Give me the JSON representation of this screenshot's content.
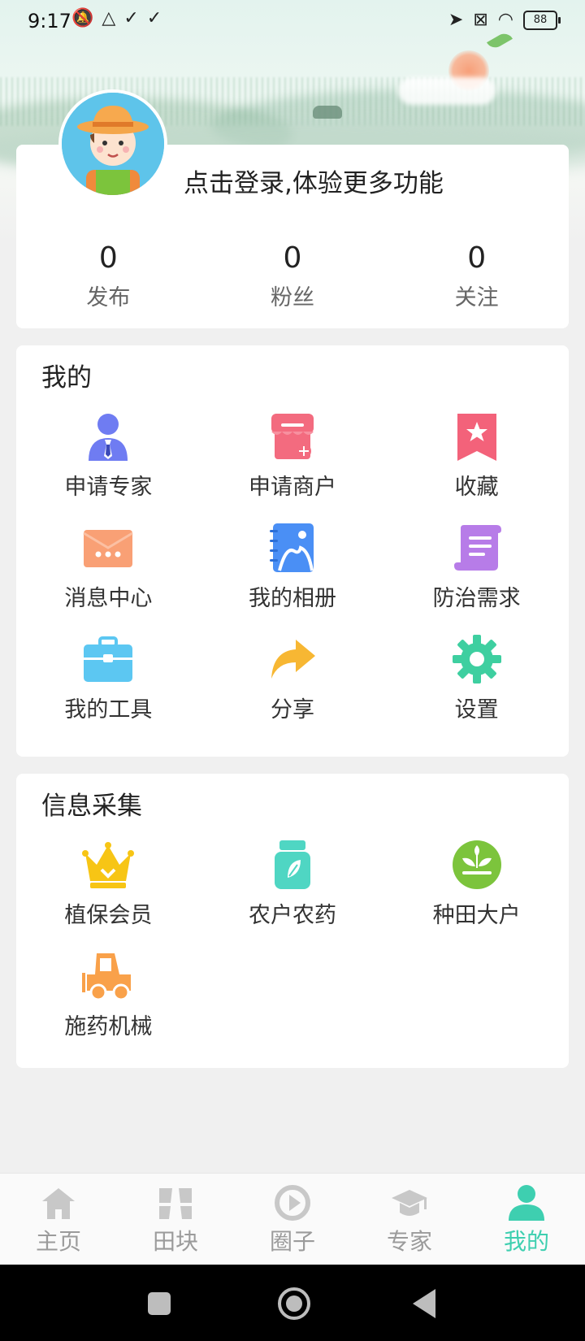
{
  "status_bar": {
    "time": "9:17",
    "battery": "88"
  },
  "profile": {
    "login_prompt": "点击登录,体验更多功能",
    "stats": [
      {
        "value": "0",
        "label": "发布"
      },
      {
        "value": "0",
        "label": "粉丝"
      },
      {
        "value": "0",
        "label": "关注"
      }
    ]
  },
  "mine": {
    "title": "我的",
    "items": [
      {
        "label": "申请专家",
        "icon": "expert-icon",
        "color": "#6f7cf2"
      },
      {
        "label": "申请商户",
        "icon": "store-icon",
        "color": "#f36b7f"
      },
      {
        "label": "收藏",
        "icon": "bookmark-icon",
        "color": "#f3627a"
      },
      {
        "label": "消息中心",
        "icon": "message-icon",
        "color": "#f9a075"
      },
      {
        "label": "我的相册",
        "icon": "album-icon",
        "color": "#4a8ff5"
      },
      {
        "label": "防治需求",
        "icon": "scroll-icon",
        "color": "#b77ce8"
      },
      {
        "label": "我的工具",
        "icon": "toolbox-icon",
        "color": "#5cc7f2"
      },
      {
        "label": "分享",
        "icon": "share-icon",
        "color": "#f7b733"
      },
      {
        "label": "设置",
        "icon": "gear-icon",
        "color": "#3ecfa0"
      }
    ]
  },
  "collect": {
    "title": "信息采集",
    "items": [
      {
        "label": "植保会员",
        "icon": "crown-icon",
        "color": "#f7c515"
      },
      {
        "label": "农户农药",
        "icon": "pesticide-bottle-icon",
        "color": "#4fd6c3"
      },
      {
        "label": "种田大户",
        "icon": "sprout-icon",
        "color": "#7cc43c"
      },
      {
        "label": "施药机械",
        "icon": "tractor-icon",
        "color": "#f9a14a"
      }
    ]
  },
  "bottom_nav": {
    "active_color": "#3ecfb0",
    "items": [
      {
        "label": "主页",
        "icon": "home-icon"
      },
      {
        "label": "田块",
        "icon": "field-icon"
      },
      {
        "label": "圈子",
        "icon": "circle-icon"
      },
      {
        "label": "专家",
        "icon": "graduation-cap-icon"
      },
      {
        "label": "我的",
        "icon": "person-icon",
        "active": true
      }
    ]
  }
}
